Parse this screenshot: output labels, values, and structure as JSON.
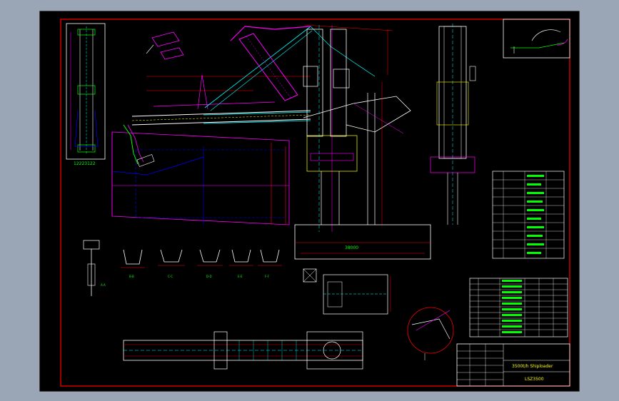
{
  "drawing": {
    "side_view_tag": "12223122",
    "title_block": {
      "title": "3500t/h Shiploader",
      "drawing_no": "LSZ3500"
    },
    "dimensions": {
      "main_span": "38000"
    },
    "section_labels": [
      "A-A",
      "B-B",
      "C-C",
      "D-D",
      "E-E",
      "F-F"
    ],
    "colors": {
      "background": "#000000",
      "frame": "#ff0000",
      "outline": "#ffffff",
      "hidden": "#0000ff",
      "centerline": "#ff00ff",
      "dimension": "#00ffff",
      "text": "#00ff00",
      "yellow": "#ffff00",
      "page": "#9aa6b6"
    }
  }
}
